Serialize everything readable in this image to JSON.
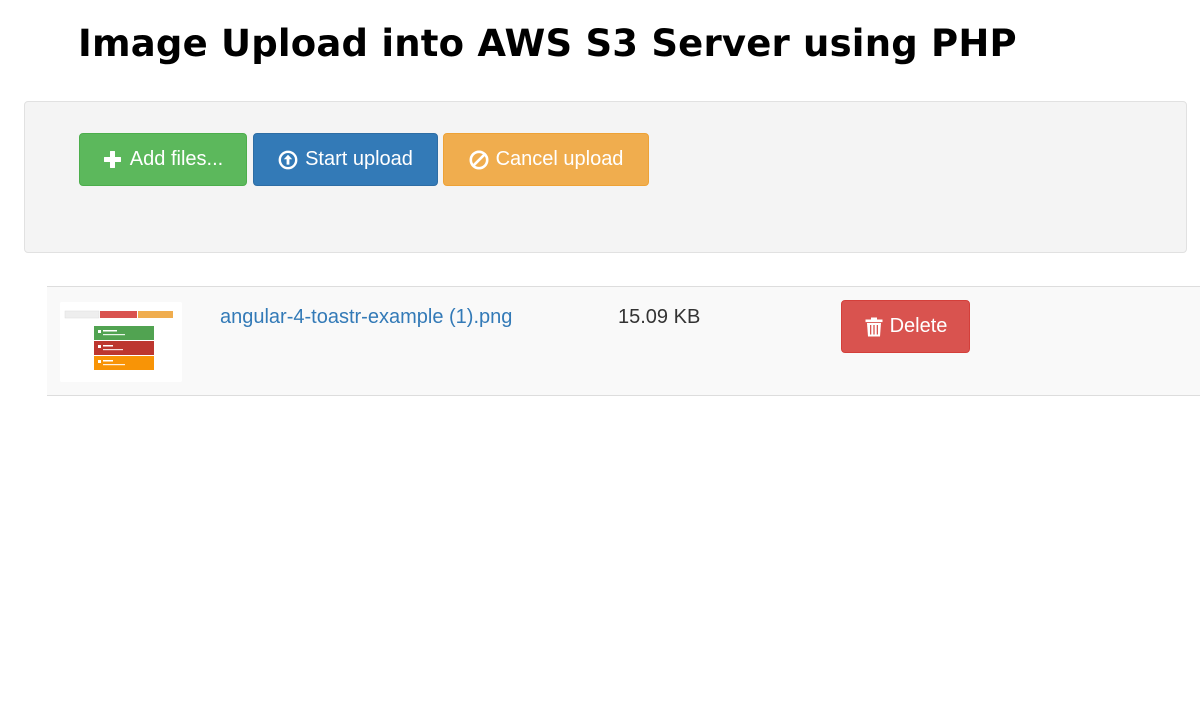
{
  "page": {
    "title": "Image Upload into AWS S3 Server using PHP"
  },
  "toolbar": {
    "add_files_label": "Add files...",
    "start_upload_label": "Start upload",
    "cancel_upload_label": "Cancel upload",
    "icons": {
      "add": "plus-icon",
      "start": "circle-arrow-up-icon",
      "cancel": "ban-icon"
    }
  },
  "files": [
    {
      "name": "angular-4-toastr-example (1).png",
      "size": "15.09 KB",
      "delete_label": "Delete",
      "delete_icon": "trash-icon"
    }
  ],
  "colors": {
    "success": "#5cb85c",
    "primary": "#337ab7",
    "warning": "#f0ad4e",
    "danger": "#d9534f",
    "link": "#337ab7"
  }
}
